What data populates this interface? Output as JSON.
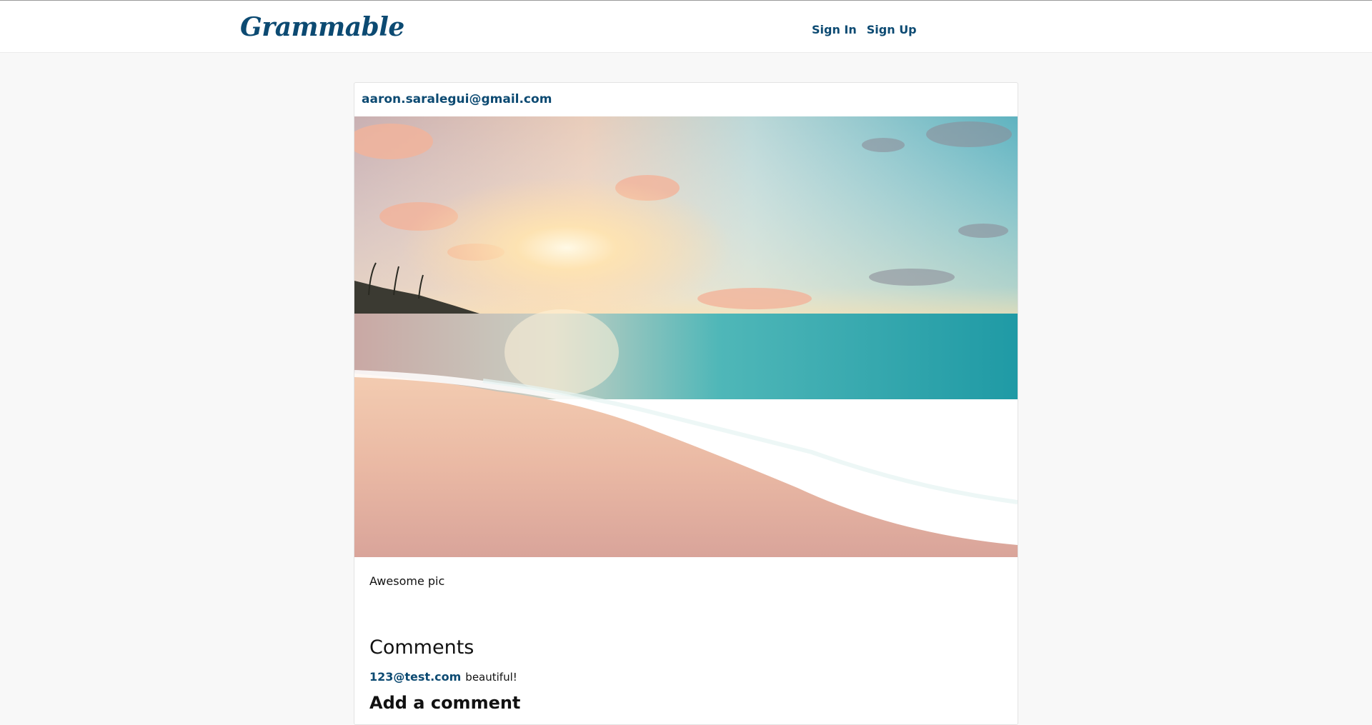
{
  "header": {
    "brand": "Grammable",
    "nav": [
      {
        "label": "Sign In"
      },
      {
        "label": "Sign Up"
      }
    ]
  },
  "post": {
    "author": "aaron.saralegui@gmail.com",
    "image_alt": "beach-sunset-photo",
    "caption": "Awesome pic",
    "comments_heading": "Comments",
    "comments": [
      {
        "user": "123@test.com",
        "text": "beautiful!"
      }
    ],
    "add_comment_heading": "Add a comment"
  },
  "colors": {
    "brand": "#0c4a72",
    "page_bg": "#f8f8f8",
    "card_bg": "#ffffff"
  }
}
